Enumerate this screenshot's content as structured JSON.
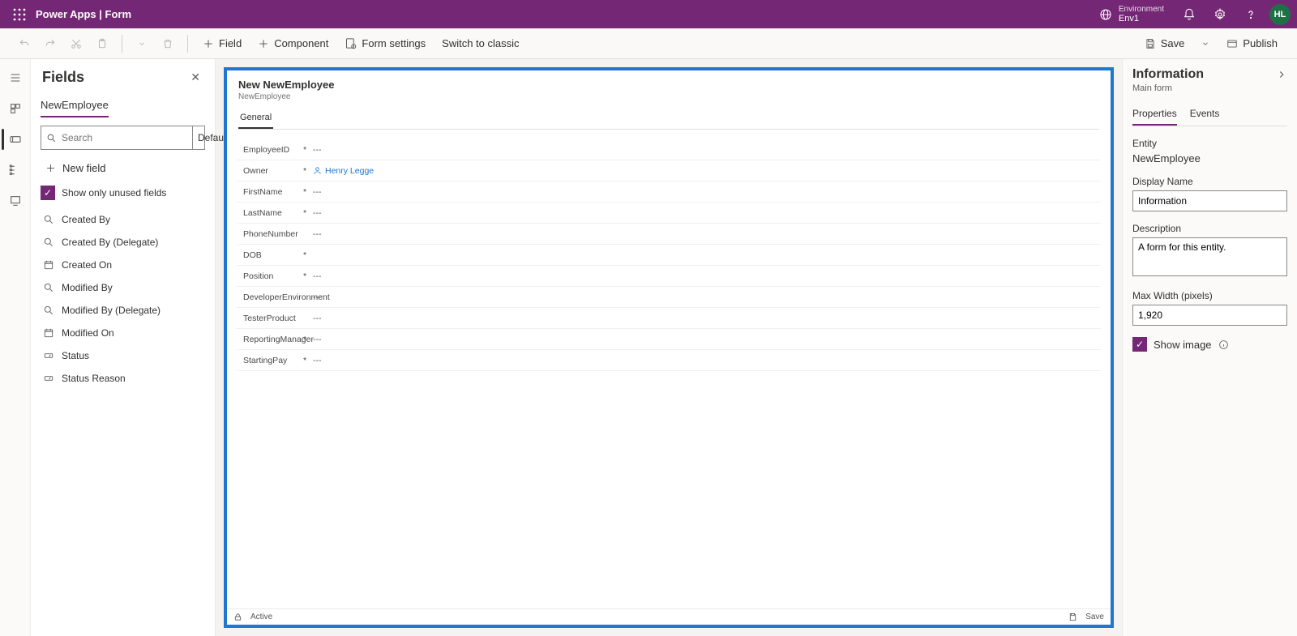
{
  "topbar": {
    "app_title": "Power Apps  |  Form",
    "env_label": "Environment",
    "env_name": "Env1",
    "avatar_initials": "HL"
  },
  "cmdbar": {
    "field": "Field",
    "component": "Component",
    "form_settings": "Form settings",
    "switch_classic": "Switch to classic",
    "save": "Save",
    "publish": "Publish"
  },
  "fields_panel": {
    "title": "Fields",
    "entity": "NewEmployee",
    "search_placeholder": "Search",
    "sort_label": "Default",
    "new_field": "New field",
    "show_unused": "Show only unused fields",
    "items": [
      {
        "icon": "lookup",
        "label": "Created By"
      },
      {
        "icon": "lookup",
        "label": "Created By (Delegate)"
      },
      {
        "icon": "datetime",
        "label": "Created On"
      },
      {
        "icon": "lookup",
        "label": "Modified By"
      },
      {
        "icon": "lookup",
        "label": "Modified By (Delegate)"
      },
      {
        "icon": "datetime",
        "label": "Modified On"
      },
      {
        "icon": "option",
        "label": "Status"
      },
      {
        "icon": "option",
        "label": "Status Reason"
      }
    ]
  },
  "form": {
    "title": "New NewEmployee",
    "subtitle": "NewEmployee",
    "tab": "General",
    "rows": [
      {
        "label": "EmployeeID",
        "required": true,
        "value": "---"
      },
      {
        "label": "Owner",
        "required": true,
        "value": "Henry Legge",
        "is_link": true
      },
      {
        "label": "FirstName",
        "required": true,
        "value": "---"
      },
      {
        "label": "LastName",
        "required": true,
        "value": "---"
      },
      {
        "label": "PhoneNumber",
        "required": false,
        "value": "---"
      },
      {
        "label": "DOB",
        "required": true,
        "value": ""
      },
      {
        "label": "Position",
        "required": true,
        "value": "---"
      },
      {
        "label": "DeveloperEnvironment",
        "required": false,
        "value": "---"
      },
      {
        "label": "TesterProduct",
        "required": false,
        "value": "---"
      },
      {
        "label": "ReportingManager",
        "required": true,
        "value": "---"
      },
      {
        "label": "StartingPay",
        "required": true,
        "value": "---"
      }
    ],
    "footer_status": "Active",
    "footer_save": "Save"
  },
  "props": {
    "title": "Information",
    "subtitle": "Main form",
    "tab_properties": "Properties",
    "tab_events": "Events",
    "entity_label": "Entity",
    "entity_value": "NewEmployee",
    "display_name_label": "Display Name",
    "display_name_value": "Information",
    "description_label": "Description",
    "description_value": "A form for this entity.",
    "maxwidth_label": "Max Width (pixels)",
    "maxwidth_value": "1,920",
    "show_image": "Show image"
  }
}
